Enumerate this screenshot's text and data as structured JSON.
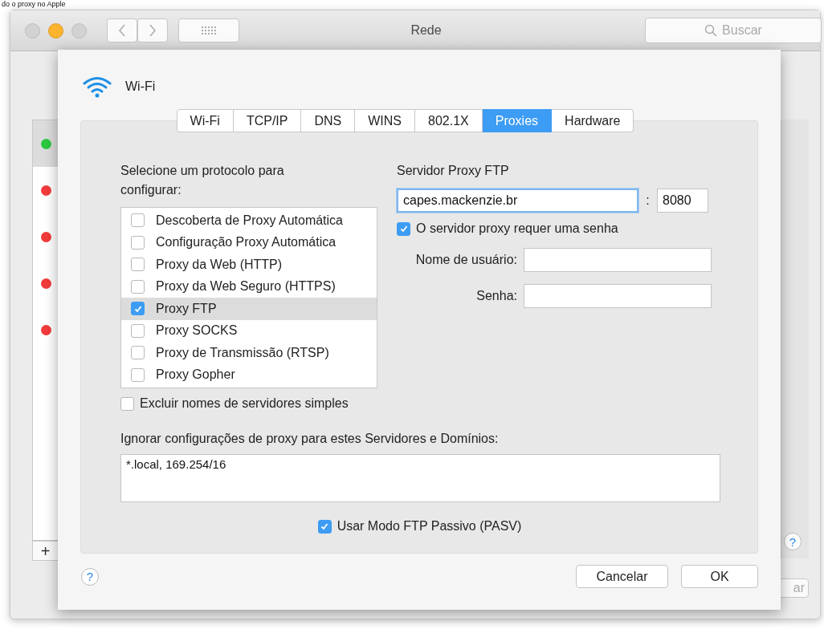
{
  "caption": "do o proxy no Apple",
  "window": {
    "title": "Rede",
    "search": {
      "placeholder": "Buscar"
    }
  },
  "services": [
    {
      "color": "#2bc840",
      "selected": true
    },
    {
      "color": "#f23b3b",
      "selected": false
    },
    {
      "color": "#f23b3b",
      "selected": false
    },
    {
      "color": "#f23b3b",
      "selected": false
    },
    {
      "color": "#f23b3b",
      "selected": false
    }
  ],
  "add_button": "+",
  "background_help": "?",
  "apply_button": "ar",
  "dialog": {
    "interface": "Wi-Fi",
    "tabs": [
      {
        "label": "Wi-Fi",
        "selected": false
      },
      {
        "label": "TCP/IP",
        "selected": false
      },
      {
        "label": "DNS",
        "selected": false
      },
      {
        "label": "WINS",
        "selected": false
      },
      {
        "label": "802.1X",
        "selected": false
      },
      {
        "label": "Proxies",
        "selected": true
      },
      {
        "label": "Hardware",
        "selected": false
      }
    ],
    "protocol_label": "Selecione um protocolo para configurar:",
    "protocols": [
      {
        "label": "Descoberta de Proxy Automática",
        "checked": false,
        "selected": false
      },
      {
        "label": "Configuração Proxy Automática",
        "checked": false,
        "selected": false
      },
      {
        "label": "Proxy da Web (HTTP)",
        "checked": false,
        "selected": false
      },
      {
        "label": "Proxy da Web Seguro (HTTPS)",
        "checked": false,
        "selected": false
      },
      {
        "label": "Proxy FTP",
        "checked": true,
        "selected": true
      },
      {
        "label": "Proxy SOCKS",
        "checked": false,
        "selected": false
      },
      {
        "label": "Proxy de Transmissão (RTSP)",
        "checked": false,
        "selected": false
      },
      {
        "label": "Proxy Gopher",
        "checked": false,
        "selected": false
      }
    ],
    "exclude_simple": {
      "label": "Excluir nomes de servidores simples",
      "checked": false
    },
    "server_label": "Servidor Proxy FTP",
    "server": {
      "value": "capes.mackenzie.br",
      "focused": true
    },
    "colon": ":",
    "port": "8080",
    "password_required": {
      "label": "O servidor proxy requer uma senha",
      "checked": true
    },
    "username_label": "Nome de usuário:",
    "password_label": "Senha:",
    "bypass_label": "Ignorar configurações de proxy para estes Servidores e Domínios:",
    "bypass_value": "*.local, 169.254/16",
    "passive_ftp": {
      "label": "Usar Modo FTP Passivo (PASV)",
      "checked": true
    },
    "help": "?",
    "buttons": [
      "Cancelar",
      "OK"
    ]
  }
}
